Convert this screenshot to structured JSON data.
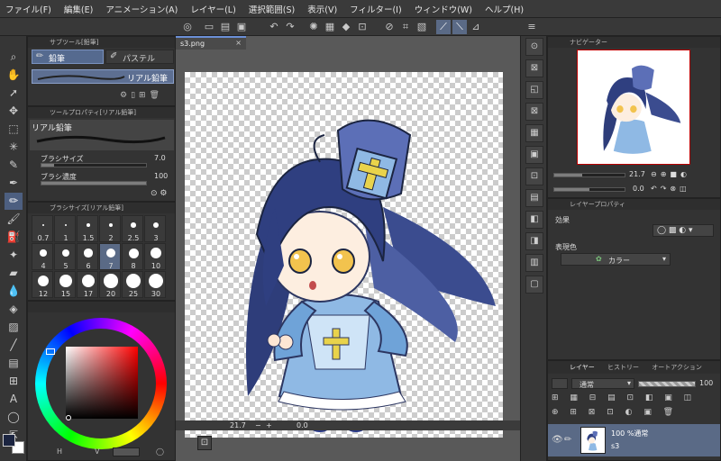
{
  "menu": [
    "ファイル(F)",
    "編集(E)",
    "アニメーション(A)",
    "レイヤー(L)",
    "選択範囲(S)",
    "表示(V)",
    "フィルター(I)",
    "ウィンドウ(W)",
    "ヘルプ(H)"
  ],
  "subtool": {
    "tab_title": "サブツール[鉛筆]",
    "tabs": [
      "鉛筆",
      "パステル"
    ],
    "brush_name": "リアル鉛筆"
  },
  "tool_property": {
    "tab_title": "ツールプロパティ[リアル鉛筆]",
    "brush_name": "リアル鉛筆",
    "size_label": "ブラシサイズ",
    "size_value": "7.0",
    "density_label": "ブラシ濃度",
    "density_value": "100",
    "size_fraction": 0.12,
    "density_fraction": 1.0
  },
  "brush_size": {
    "tab_title": "ブラシサイズ[リアル鉛筆]",
    "sizes": [
      "0.7",
      "1",
      "1.5",
      "2",
      "2.5",
      "3",
      "4",
      "5",
      "6",
      "7",
      "8",
      "10",
      "12",
      "15",
      "17",
      "20",
      "25",
      "30"
    ],
    "selected": "7"
  },
  "color": {
    "main_color": "#1b2440",
    "sub_color": "#ffffff"
  },
  "document": {
    "tab_name": "s3.png",
    "zoom": "21.7",
    "angle": "0.0"
  },
  "navigator": {
    "tab_title": "ナビゲーター",
    "zoom": "21.7",
    "angle": "0.0"
  },
  "layer_property": {
    "tab_title": "レイヤープロパティ",
    "effect_label": "効果",
    "expression_label": "表現色",
    "expression_value": "カラー"
  },
  "layers": {
    "tabs": [
      "レイヤー",
      "ヒストリー",
      "オートアクション"
    ],
    "blend_mode": "通常",
    "opacity": "100",
    "items": [
      {
        "info": "100 %通常",
        "name": "s3"
      }
    ]
  }
}
